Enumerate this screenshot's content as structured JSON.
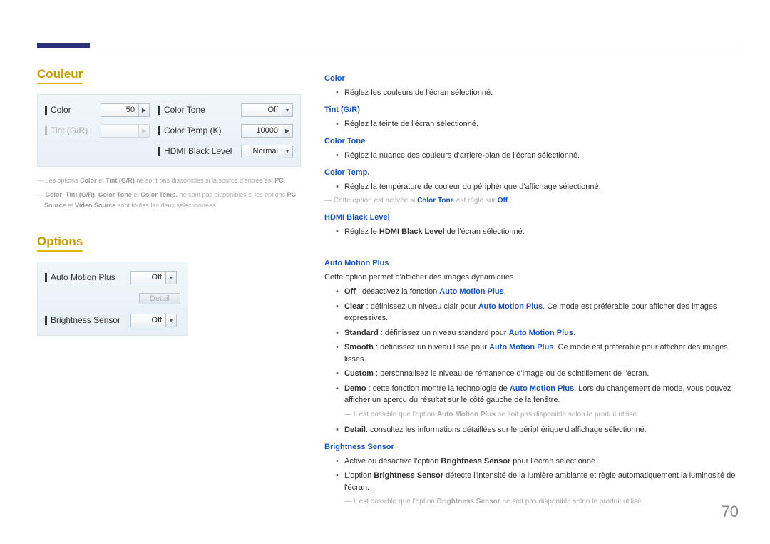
{
  "page_number": "70",
  "sections": {
    "couleur": {
      "title": "Couleur",
      "panel": {
        "left": [
          {
            "label": "Color",
            "value": "50",
            "arrow": "▶",
            "disabled": false
          },
          {
            "label": "Tint (G/R)",
            "value": "",
            "arrow": "▶",
            "disabled": true
          }
        ],
        "right": [
          {
            "label": "Color Tone",
            "value": "Off",
            "arrow": "▾"
          },
          {
            "label": "Color Temp (K)",
            "value": "10000",
            "arrow": "▶"
          },
          {
            "label": "HDMI Black Level",
            "value": "Normal",
            "arrow": "▾"
          }
        ]
      },
      "notes": [
        "Les options <b>Color</b> et <b>Tint (G/R)</b> ne sont pas disponibles si la source d'entrée est <b>PC</b>.",
        "<b>Color</b>, <b>Tint (G/R)</b>, <b>Color Tone</b> et <b>Color Temp.</b> ne sont pas disponibles si les options <b>PC Source</b> et <b>Video Source</b> sont toutes les deux sélectionnées."
      ]
    },
    "options": {
      "title": "Options",
      "panel": [
        {
          "label": "Auto Motion Plus",
          "value": "Off",
          "arrow": "▾"
        },
        {
          "detail_label": "Detail"
        },
        {
          "label": "Brightness Sensor",
          "value": "Off",
          "arrow": "▾"
        }
      ]
    }
  },
  "right": {
    "color": {
      "h": "Color",
      "li": "Réglez les couleurs de l'écran sélectionné."
    },
    "tint": {
      "h": "Tint (G/R)",
      "li": "Réglez la teinte de l'écran sélectionné."
    },
    "colortone": {
      "h": "Color Tone",
      "li": "Réglez la nuance des couleurs d'arrière-plan de l'écran sélectionné."
    },
    "colortemp": {
      "h": "Color Temp.",
      "li": "Réglez la température de couleur du périphérique d'affichage sélectionné.",
      "note": "Cette option est activée si <b class=\"link\">Color Tone</b> est réglé sur <b class=\"link\">Off</b>."
    },
    "hdmi": {
      "h": "HDMI Black Level",
      "li": "Réglez le <b class=\"term\">HDMI Black Level</b> de l'écran sélectionné."
    },
    "amp": {
      "h": "Auto Motion Plus",
      "intro": "Cette option permet d'afficher des images dynamiques.",
      "items": [
        "<b class=\"term\">Off</b> : désactivez la fonction <b class=\"link\">Auto Motion Plus</b>.",
        "<b class=\"term\">Clear</b> : définissez un niveau clair pour <b class=\"link\">Auto Motion Plus</b>. Ce mode est préférable pour afficher des images expressives.",
        "<b class=\"term\">Standard</b> : définissez un niveau standard pour <b class=\"link\">Auto Motion Plus</b>.",
        "<b class=\"term\">Smooth</b> : définissez un niveau lisse pour <b class=\"link\">Auto Motion Plus</b>. Ce mode est préférable pour afficher des images lisses.",
        "<b class=\"term\">Custom</b> : personnalisez le niveau de rémanence d'image ou de scintillement de l'écran.",
        "<b class=\"term\">Demo</b> : cette fonction montre la technologie de <b class=\"link\">Auto Motion Plus</b>. Lors du changement de mode, vous pouvez afficher un aperçu du résultat sur le côté gauche de la fenêtre."
      ],
      "note": "Il est possible que l'option <b>Auto Motion Plus</b> ne soit pas disponible selon le produit utilisé.",
      "detail": "<b class=\"term\">Detail</b>: consultez les informations détaillées sur le périphérique d'affichage sélectionné."
    },
    "bs": {
      "h": "Brightness Sensor",
      "items": [
        "Active ou désactive l'option <b class=\"term\">Brightness Sensor</b> pour l'écran sélectionné.",
        "L'option <b class=\"term\">Brightness Sensor</b> détecte l'intensité de la lumière ambiante et règle automatiquement la luminosité de l'écran."
      ],
      "note": "Il est possible que l'option <b>Brightness Sensor</b> ne soit pas disponible selon le produit utilisé."
    }
  }
}
